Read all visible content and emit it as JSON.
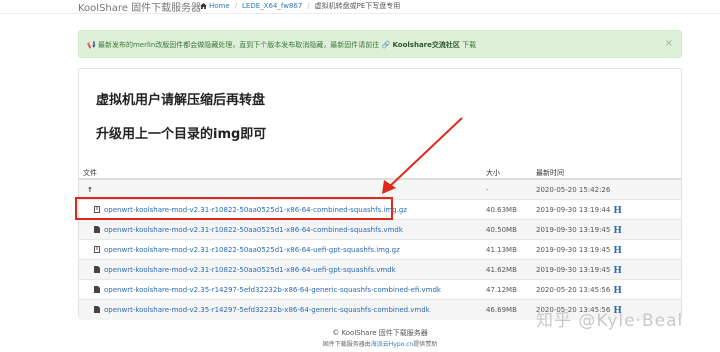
{
  "header": {
    "brand": "KoolShare 固件下载服务器",
    "breadcrumb": [
      "Home",
      "LEDE_X64_fw867",
      "虚拟机转盘或PE下写盘专用"
    ]
  },
  "alert": {
    "prefix": "最新发布的merlin改版固件都会做隐藏处理，直到下个版本发布取消隐藏，最新固件请前往",
    "link": "Koolshare交流社区",
    "suffix": "下载",
    "close": "×"
  },
  "panel": {
    "heading1": "虚拟机用户请解压缩后再转盘",
    "heading2": "升级用上一个目录的img即可"
  },
  "table": {
    "headers": {
      "name": "文件",
      "size": "大小",
      "date": "最新时间"
    },
    "parent": {
      "name": "↑",
      "size": "-",
      "date": "2020-05-20 15:42:26"
    },
    "rows": [
      {
        "name": "openwrt-koolshare-mod-v2.31-r10822-50aa0525d1-x86-64-combined-squashfs.img.gz",
        "size": "40.63MB",
        "date": "2019-09-30 13:19:44",
        "badge": "H"
      },
      {
        "name": "openwrt-koolshare-mod-v2.31-r10822-50aa0525d1-x86-64-combined-squashfs.vmdk",
        "size": "40.50MB",
        "date": "2019-09-30 13:19:45",
        "badge": "H"
      },
      {
        "name": "openwrt-koolshare-mod-v2.31-r10822-50aa0525d1-x86-64-uefi-gpt-squashfs.img.gz",
        "size": "41.13MB",
        "date": "2019-09-30 13:19:45",
        "badge": "H"
      },
      {
        "name": "openwrt-koolshare-mod-v2.31-r10822-50aa0525d1-x86-64-uefi-gpt-squashfs.vmdk",
        "size": "41.62MB",
        "date": "2019-09-30 13:19:45",
        "badge": "H"
      },
      {
        "name": "openwrt-koolshare-mod-v2.35-r14297-5efd32232b-x86-64-generic-squashfs-combined-efi.vmdk",
        "size": "47.12MB",
        "date": "2020-05-20 13:45:56",
        "badge": "H"
      },
      {
        "name": "openwrt-koolshare-mod-v2.35-r14297-5efd32232b-x86-64-generic-squashfs-combined.vmdk",
        "size": "46.69MB",
        "date": "2020-05-20 13:45:56",
        "badge": "H"
      }
    ]
  },
  "footer": {
    "line1": "© KoolShare 固件下载服务器",
    "line2_prefix": "固件下载服务器由",
    "line2_link": "海派云Hypo.cn",
    "line2_suffix": "提供赞助"
  },
  "watermark": "知乎 @Kyle·Beal",
  "colors": {
    "accent": "#2a6ab0",
    "alert_bg": "#dff0d8",
    "highlight": "#e0281e"
  }
}
